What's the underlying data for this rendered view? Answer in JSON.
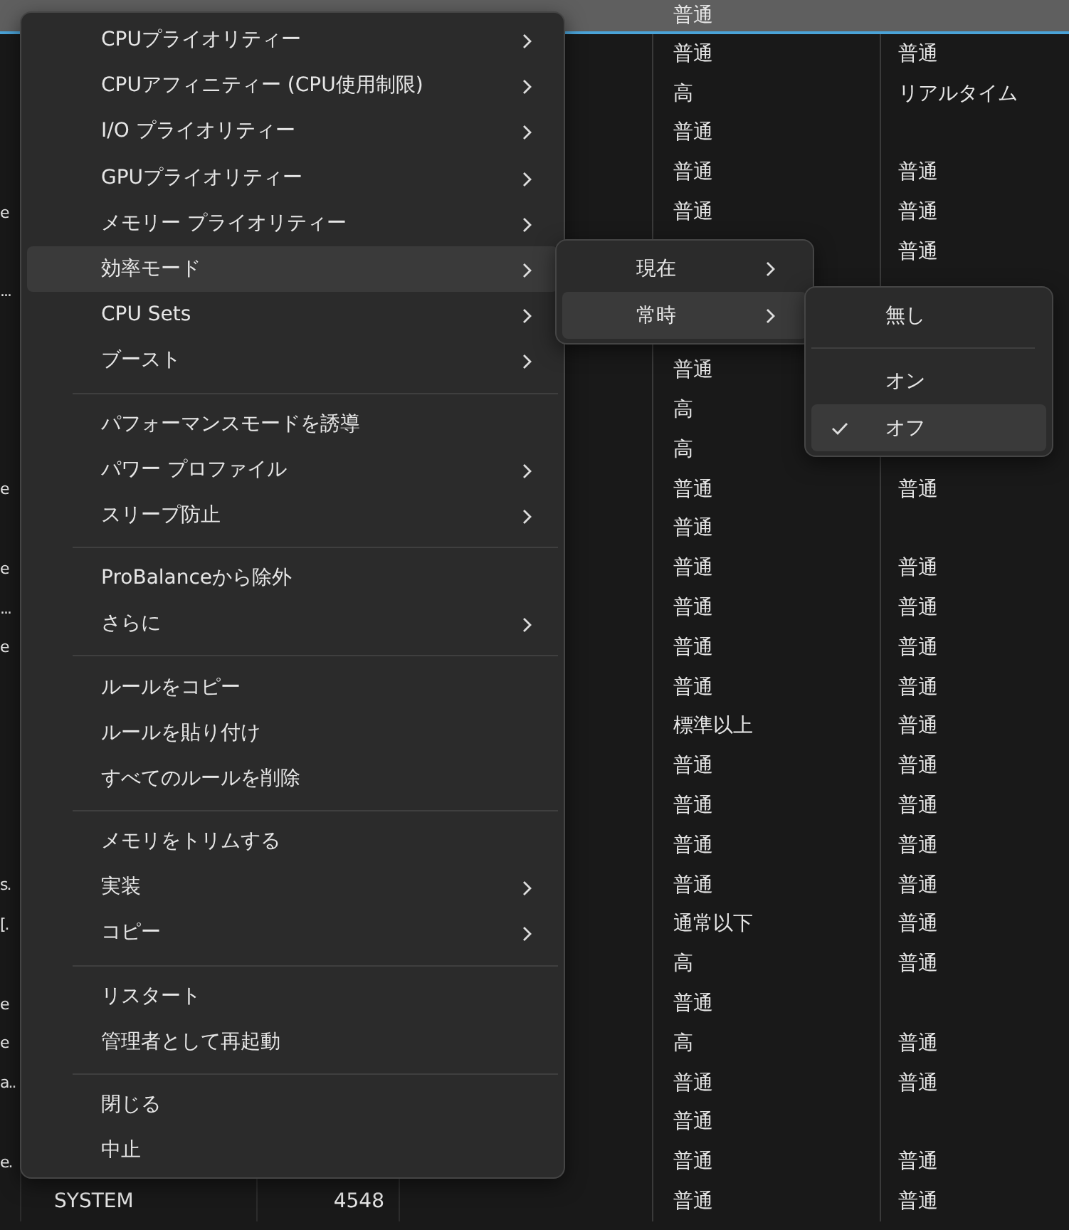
{
  "table": {
    "rows": [
      {
        "selected": true,
        "priority": "普通"
      },
      {
        "selected": false,
        "priority": "普通",
        "priority_2": "普通"
      },
      {
        "selected": false,
        "priority": "高",
        "priority_2": "リアルタイム"
      },
      {
        "selected": false,
        "priority": "普通"
      },
      {
        "selected": false,
        "priority": "普通",
        "priority_2": "普通"
      },
      {
        "selected": false,
        "edge": "e",
        "priority": "普通",
        "priority_2": "普通"
      },
      {
        "selected": false,
        "priority_2": "普通"
      },
      {
        "selected": false,
        "edge": "..."
      },
      {
        "selected": false
      },
      {
        "selected": false,
        "priority": "普通"
      },
      {
        "selected": false,
        "priority": "高"
      },
      {
        "selected": false,
        "priority": "高"
      },
      {
        "selected": false,
        "edge": "e",
        "priority": "普通",
        "priority_2": "普通"
      },
      {
        "selected": false,
        "priority": "普通"
      },
      {
        "selected": false,
        "edge": "e",
        "priority": "普通",
        "priority_2": "普通"
      },
      {
        "selected": false,
        "edge": "...",
        "priority": "普通",
        "priority_2": "普通"
      },
      {
        "selected": false,
        "edge": "e",
        "priority": "普通",
        "priority_2": "普通"
      },
      {
        "selected": false,
        "priority": "普通",
        "priority_2": "普通"
      },
      {
        "selected": false,
        "priority": "標準以上",
        "priority_2": "普通"
      },
      {
        "selected": false,
        "priority": "普通",
        "priority_2": "普通"
      },
      {
        "selected": false,
        "priority": "普通",
        "priority_2": "普通"
      },
      {
        "selected": false,
        "priority": "普通",
        "priority_2": "普通"
      },
      {
        "selected": false,
        "edge": "s.",
        "priority": "普通",
        "priority_2": "普通"
      },
      {
        "selected": false,
        "edge": "[.",
        "priority": "通常以下",
        "priority_2": "普通"
      },
      {
        "selected": false,
        "priority": "高",
        "priority_2": "普通"
      },
      {
        "selected": false,
        "edge": "e",
        "priority": "普通"
      },
      {
        "selected": false,
        "edge": "e",
        "priority": "高",
        "priority_2": "普通"
      },
      {
        "selected": false,
        "edge": "a..",
        "priority": "普通",
        "priority_2": "普通"
      },
      {
        "selected": false,
        "priority": "普通"
      },
      {
        "selected": false,
        "edge": "e.",
        "priority": "普通",
        "priority_2": "普通"
      },
      {
        "selected": false,
        "user": "SYSTEM",
        "pid": "4548",
        "priority": "普通",
        "priority_2": "普通"
      }
    ]
  },
  "context_menu": {
    "groups": [
      [
        {
          "label": "CPUプライオリティー",
          "submenu": true,
          "highlighted": false
        },
        {
          "label": "CPUアフィニティー (CPU使用制限)",
          "submenu": true,
          "highlighted": false
        },
        {
          "label": "I/O プライオリティー",
          "submenu": true,
          "highlighted": false
        },
        {
          "label": "GPUプライオリティー",
          "submenu": true,
          "highlighted": false
        },
        {
          "label": "メモリー プライオリティー",
          "submenu": true,
          "highlighted": false
        },
        {
          "label": "効率モード",
          "submenu": true,
          "highlighted": true
        },
        {
          "label": "CPU Sets",
          "submenu": true,
          "highlighted": false
        },
        {
          "label": "ブースト",
          "submenu": true,
          "highlighted": false
        }
      ],
      [
        {
          "label": "パフォーマンスモードを誘導",
          "submenu": false,
          "highlighted": false
        },
        {
          "label": "パワー プロファイル",
          "submenu": true,
          "highlighted": false
        },
        {
          "label": "スリープ防止",
          "submenu": true,
          "highlighted": false
        }
      ],
      [
        {
          "label": "ProBalanceから除外",
          "submenu": false,
          "highlighted": false
        },
        {
          "label": "さらに",
          "submenu": true,
          "highlighted": false
        }
      ],
      [
        {
          "label": "ルールをコピー",
          "submenu": false,
          "highlighted": false
        },
        {
          "label": "ルールを貼り付け",
          "submenu": false,
          "highlighted": false
        },
        {
          "label": "すべてのルールを削除",
          "submenu": false,
          "highlighted": false
        }
      ],
      [
        {
          "label": "メモリをトリムする",
          "submenu": false,
          "highlighted": false
        },
        {
          "label": "実装",
          "submenu": true,
          "highlighted": false
        },
        {
          "label": "コピー",
          "submenu": true,
          "highlighted": false
        }
      ],
      [
        {
          "label": "リスタート",
          "submenu": false,
          "highlighted": false
        },
        {
          "label": "管理者として再起動",
          "submenu": false,
          "highlighted": false
        }
      ],
      [
        {
          "label": "閉じる",
          "submenu": false,
          "highlighted": false
        },
        {
          "label": "中止",
          "submenu": false,
          "highlighted": false
        }
      ]
    ]
  },
  "efficiency_submenu": {
    "items": [
      {
        "label": "現在",
        "submenu": true,
        "highlighted": false
      },
      {
        "label": "常時",
        "submenu": true,
        "highlighted": true
      }
    ]
  },
  "always_submenu": {
    "groups": [
      [
        {
          "label": "無し",
          "checked": false,
          "highlighted": false
        }
      ],
      [
        {
          "label": "オン",
          "checked": false,
          "highlighted": false
        },
        {
          "label": "オフ",
          "checked": true,
          "highlighted": true
        }
      ]
    ]
  }
}
